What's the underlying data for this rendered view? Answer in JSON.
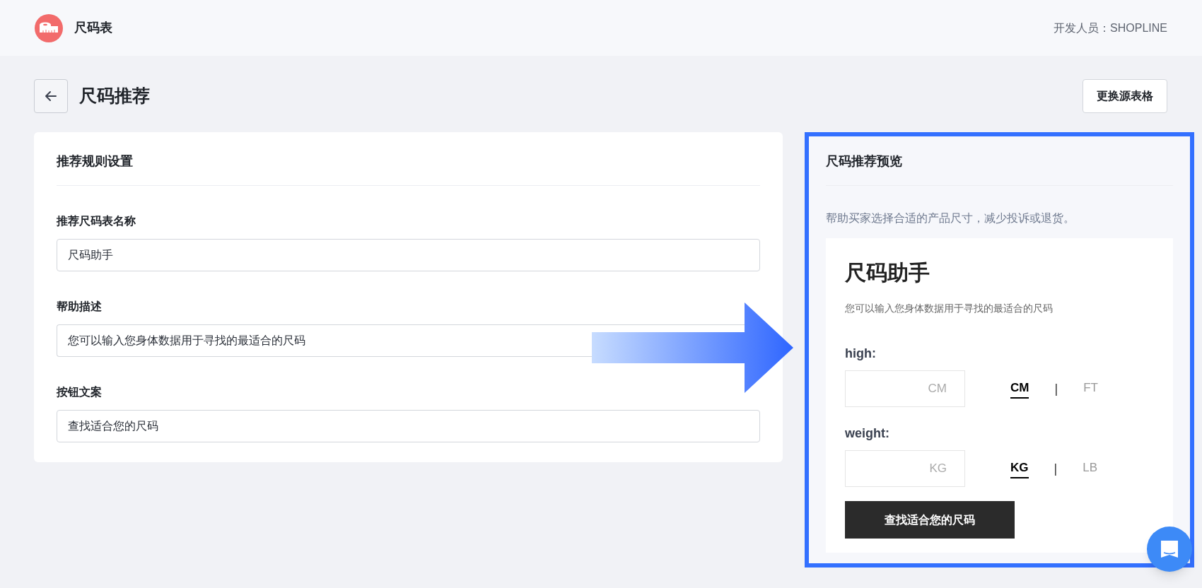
{
  "header": {
    "app_title": "尺码表",
    "developer": "开发人员：SHOPLINE"
  },
  "page": {
    "title": "尺码推荐",
    "action_button": "更换源表格"
  },
  "settings_card": {
    "title": "推荐规则设置",
    "fields": [
      {
        "label": "推荐尺码表名称",
        "value": "尺码助手"
      },
      {
        "label": "帮助描述",
        "value": "您可以输入您身体数据用于寻找的最适合的尺码"
      },
      {
        "label": "按钮文案",
        "value": "查找适合您的尺码"
      }
    ]
  },
  "preview": {
    "title": "尺码推荐预览",
    "description": "帮助买家选择合适的产品尺寸，减少投诉或退货。",
    "widget": {
      "title": "尺码助手",
      "subtitle": "您可以输入您身体数据用于寻找的最适合的尺码",
      "measures": [
        {
          "label": "high:",
          "placeholder": "CM",
          "separator": "|",
          "units": [
            {
              "label": "CM",
              "selected": true
            },
            {
              "label": "FT",
              "selected": false
            }
          ]
        },
        {
          "label": "weight:",
          "placeholder": "KG",
          "separator": "|",
          "units": [
            {
              "label": "KG",
              "selected": true
            },
            {
              "label": "LB",
              "selected": false
            }
          ]
        }
      ],
      "button": "查找适合您的尺码"
    }
  }
}
